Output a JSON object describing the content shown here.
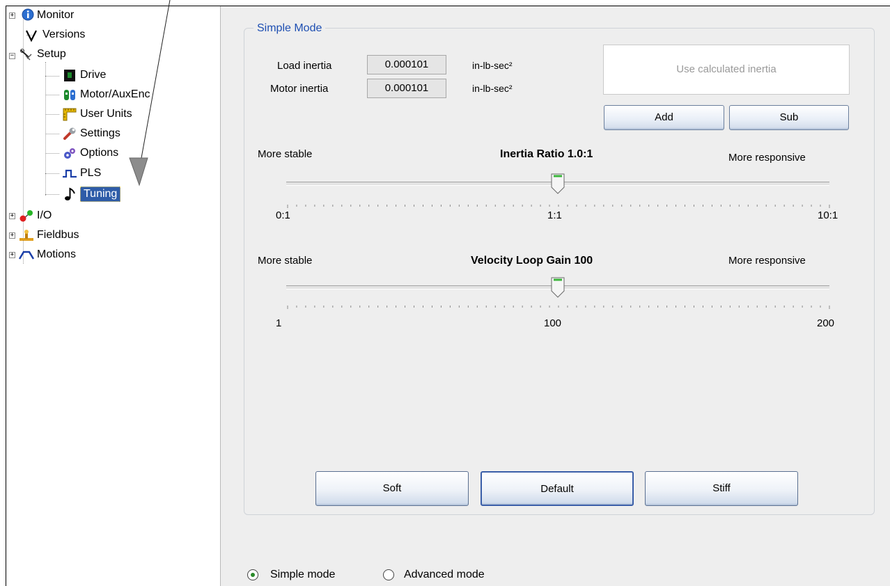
{
  "tree": {
    "items": [
      {
        "label": "Monitor",
        "icon": "info-icon"
      },
      {
        "label": "Versions",
        "icon": "versions-v-icon"
      },
      {
        "label": "Setup",
        "icon": "setup-tools-icon"
      },
      {
        "label": "Drive",
        "icon": "drive-icon"
      },
      {
        "label": "Motor/AuxEnc",
        "icon": "motor-icon"
      },
      {
        "label": "User Units",
        "icon": "ruler-icon"
      },
      {
        "label": "Settings",
        "icon": "wrench-icon"
      },
      {
        "label": "Options",
        "icon": "gears-icon"
      },
      {
        "label": "PLS",
        "icon": "pulse-icon"
      },
      {
        "label": "Tuning",
        "icon": "music-note-icon"
      },
      {
        "label": "I/O",
        "icon": "io-icon"
      },
      {
        "label": "Fieldbus",
        "icon": "fieldbus-icon"
      },
      {
        "label": "Motions",
        "icon": "motion-profile-icon"
      }
    ],
    "expanders": {
      "monitor": "+",
      "setup": "−",
      "io": "+",
      "fieldbus": "+",
      "motions": "+"
    }
  },
  "simple_mode": {
    "group_title": "Simple Mode",
    "load_inertia_label": "Load inertia",
    "load_inertia_value": "0.000101",
    "motor_inertia_label": "Motor inertia",
    "motor_inertia_value": "0.000101",
    "unit": "in-lb-sec²",
    "use_calc_label": "Use calculated inertia",
    "add_label": "Add",
    "sub_label": "Sub",
    "inertia_slider": {
      "left_label": "More stable",
      "title": "Inertia Ratio  1.0:1",
      "right_label": "More responsive",
      "min_label": "0:1",
      "mid_label": "1:1",
      "max_label": "10:1",
      "position": 0.5
    },
    "velocity_slider": {
      "left_label": "More stable",
      "title": "Velocity Loop Gain 100",
      "right_label": "More responsive",
      "min_label": "1",
      "mid_label": "100",
      "max_label": "200",
      "position": 0.5
    },
    "soft_label": "Soft",
    "default_label": "Default",
    "stiff_label": "Stiff"
  },
  "mode_select": {
    "simple_label": "Simple mode",
    "advanced_label": "Advanced mode",
    "selected": "simple"
  },
  "colors": {
    "selection": "#2e5ca8",
    "group_title": "#1e4fb2",
    "radio_dot": "#2a8a2a",
    "panel_bg": "#eeeeee"
  }
}
